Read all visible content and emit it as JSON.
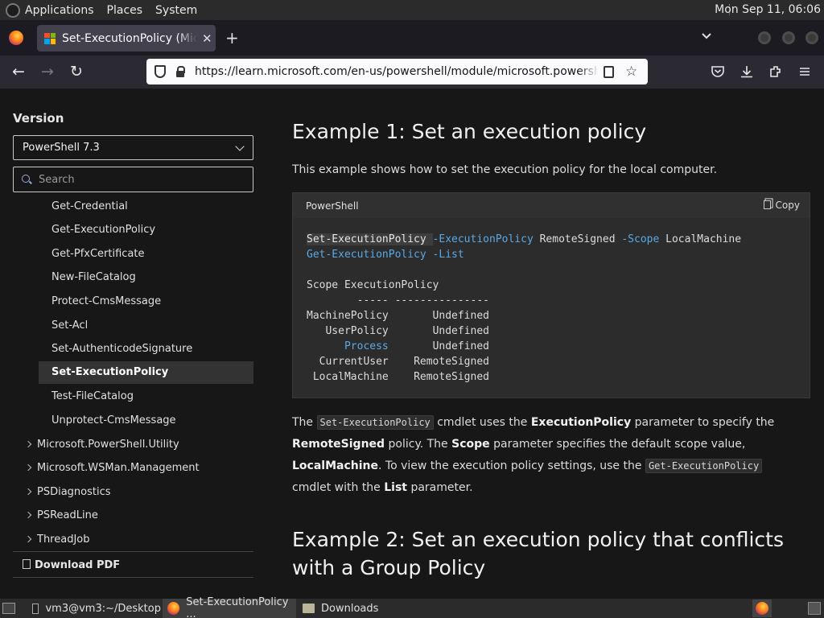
{
  "top_panel": {
    "menus": [
      "Applications",
      "Places",
      "System"
    ],
    "clock": "Mon Sep 11, 06:06"
  },
  "browser": {
    "tab_title": "Set-ExecutionPolicy (Microsoft.PowerShell.Security)",
    "url": "https://learn.microsoft.com/en-us/powershell/module/microsoft.powershell.security/set-executionpolicy"
  },
  "sidebar": {
    "version_heading": "Version",
    "version_selected": "PowerShell 7.3",
    "search_placeholder": "Search",
    "items": [
      "Get-Credential",
      "Get-ExecutionPolicy",
      "Get-PfxCertificate",
      "New-FileCatalog",
      "Protect-CmsMessage",
      "Set-Acl",
      "Set-AuthenticodeSignature",
      "Set-ExecutionPolicy",
      "Test-FileCatalog",
      "Unprotect-CmsMessage"
    ],
    "selected_item": "Set-ExecutionPolicy",
    "groups": [
      "Microsoft.PowerShell.Utility",
      "Microsoft.WSMan.Management",
      "PSDiagnostics",
      "PSReadLine",
      "ThreadJob"
    ],
    "download_pdf": "Download PDF"
  },
  "main": {
    "example1_title": "Example 1: Set an execution policy",
    "example1_desc": "This example shows how to set the execution policy for the local computer.",
    "code_lang": "PowerShell",
    "copy_label": "Copy",
    "code": {
      "line1_cmd": "Set-ExecutionPolicy",
      "line1_param1": "-ExecutionPolicy",
      "line1_value1": "RemoteSigned",
      "line1_param2": "-Scope",
      "line1_value2": "LocalMachine",
      "line2_cmd": "Get-ExecutionPolicy",
      "line2_param": "-List",
      "output_header": "Scope ExecutionPolicy",
      "output_rule": "        ----- ---------------",
      "rows": [
        {
          "scope": "MachinePolicy",
          "policy": "Undefined"
        },
        {
          "scope": "UserPolicy",
          "policy": "Undefined"
        },
        {
          "scope": "Process",
          "policy": "Undefined"
        },
        {
          "scope": "CurrentUser",
          "policy": "RemoteSigned"
        },
        {
          "scope": "LocalMachine",
          "policy": "RemoteSigned"
        }
      ]
    },
    "para": {
      "t1": "The ",
      "c1": "Set-ExecutionPolicy",
      "t2": " cmdlet uses the ",
      "b1": "ExecutionPolicy",
      "t3": " parameter to specify the ",
      "b2": "RemoteSigned",
      "t4": " policy. The ",
      "b3": "Scope",
      "t5": " parameter specifies the default scope value, ",
      "b4": "LocalMachine",
      "t6": ". To view the execution policy settings, use the ",
      "c2": "Get-ExecutionPolicy",
      "t7": " cmdlet with the ",
      "b5": "List",
      "t8": " parameter."
    },
    "example2_title_line1": "Example 2: Set an execution policy that conflicts",
    "example2_title_line2": "with a Group Policy"
  },
  "taskbar": {
    "tasks": [
      "vm3@vm3:~/Desktop",
      "Set-ExecutionPolicy ...",
      "Downloads"
    ]
  },
  "colors": {
    "accent_keyword": "#5aa9e6",
    "ms_red": "#f25022",
    "ms_green": "#7fba00",
    "ms_blue": "#00a4ef",
    "ms_yellow": "#ffb900"
  }
}
